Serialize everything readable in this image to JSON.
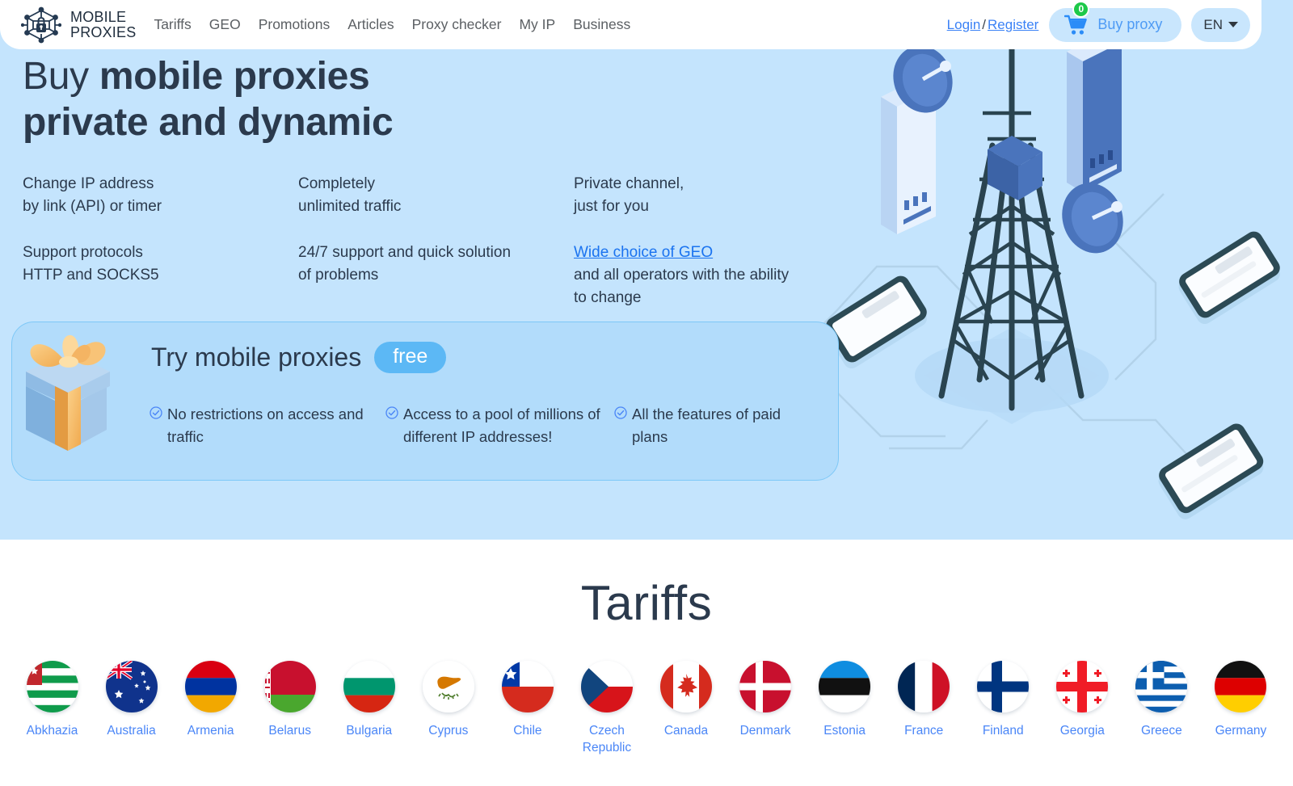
{
  "header": {
    "logo": {
      "line1": "MOBILE",
      "line2": "PROXIES",
      "icon": "hexagon-lock-logo"
    },
    "nav": [
      {
        "label": "Tariffs"
      },
      {
        "label": "GEO"
      },
      {
        "label": "Promotions"
      },
      {
        "label": "Articles"
      },
      {
        "label": "Proxy checker"
      },
      {
        "label": "My IP"
      },
      {
        "label": "Business"
      }
    ],
    "auth": {
      "login": "Login",
      "separator": "/",
      "register": "Register"
    },
    "buy_button": {
      "label": "Buy proxy",
      "badge_count": "0",
      "icon": "shopping-cart-icon"
    },
    "language": {
      "label": "EN",
      "icon": "chevron-down-icon"
    }
  },
  "hero": {
    "title_part1": "Buy ",
    "title_part2": "mobile proxies",
    "title_line2": "private and dynamic",
    "features": [
      {
        "line1": "Change IP address",
        "line2": "by link (API) or timer"
      },
      {
        "line1": "Completely",
        "line2": "unlimited traffic"
      },
      {
        "line1": "Private channel,",
        "line2": "just for you"
      },
      {
        "line1": "Support protocols",
        "line2": "HTTP and SOCKS5"
      },
      {
        "line1": "24/7 support and quick solution",
        "line2": "of problems"
      },
      {
        "link": "Wide choice of GEO",
        "line1": "and all operators with the ability",
        "line2": "to change"
      }
    ]
  },
  "promo": {
    "title": "Try mobile proxies",
    "badge": "free",
    "gift_icon": "gift-box-icon",
    "items": [
      {
        "text": "No restrictions on access and traffic"
      },
      {
        "text": "Access to a pool of millions of different IP addresses!"
      },
      {
        "text": "All the features of paid plans"
      }
    ]
  },
  "tariffs": {
    "title": "Tariffs",
    "countries": [
      {
        "name": "Abkhazia",
        "code": "abkhazia"
      },
      {
        "name": "Australia",
        "code": "australia"
      },
      {
        "name": "Armenia",
        "code": "armenia"
      },
      {
        "name": "Belarus",
        "code": "belarus"
      },
      {
        "name": "Bulgaria",
        "code": "bulgaria"
      },
      {
        "name": "Cyprus",
        "code": "cyprus"
      },
      {
        "name": "Chile",
        "code": "chile"
      },
      {
        "name": "Czech Republic",
        "code": "czech-republic"
      },
      {
        "name": "Canada",
        "code": "canada"
      },
      {
        "name": "Denmark",
        "code": "denmark"
      },
      {
        "name": "Estonia",
        "code": "estonia"
      },
      {
        "name": "France",
        "code": "france"
      },
      {
        "name": "Finland",
        "code": "finland"
      },
      {
        "name": "Georgia",
        "code": "georgia"
      },
      {
        "name": "Greece",
        "code": "greece"
      },
      {
        "name": "Germany",
        "code": "germany"
      }
    ]
  },
  "colors": {
    "hero_background": "#c4e4fd",
    "accent_blue": "#4a86f7",
    "link_blue": "#1a73f0",
    "badge_green": "#1ec94a",
    "free_badge": "#5cb8f5",
    "text_dark": "#2b3a4d",
    "promo_card": "#b2dcfb"
  }
}
